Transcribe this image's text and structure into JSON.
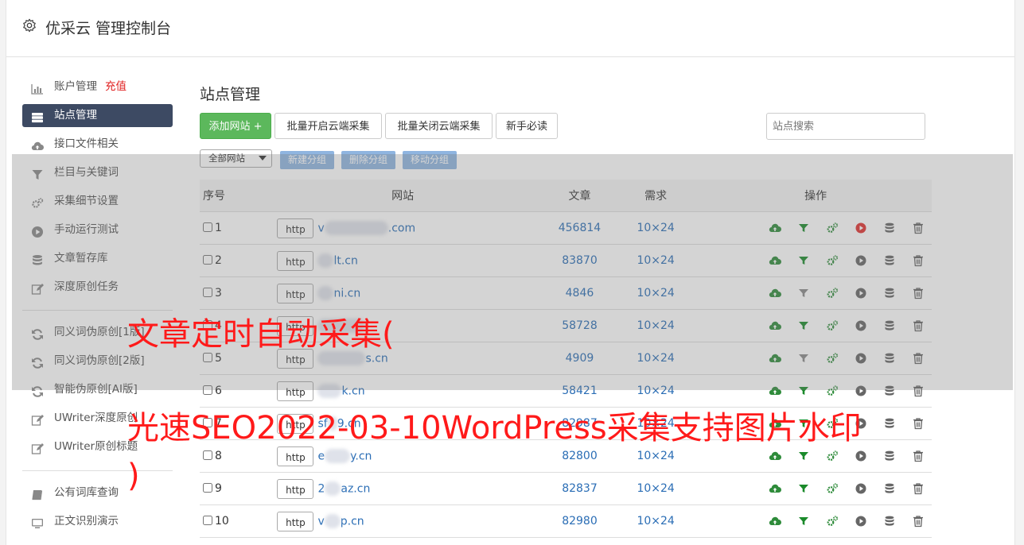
{
  "app": {
    "title": "优采云 管理控制台"
  },
  "sidebar": {
    "items": [
      {
        "label": "账户管理",
        "extra": "充值",
        "icon": "bar-chart-icon"
      },
      {
        "label": "站点管理",
        "icon": "server-icon",
        "active": true
      },
      {
        "label": "接口文件相关",
        "icon": "cloud-upload-icon"
      },
      {
        "label": "栏目与关键词",
        "icon": "filter-icon"
      },
      {
        "label": "采集细节设置",
        "icon": "cogs-icon"
      },
      {
        "label": "手动运行测试",
        "icon": "play-circle-icon"
      },
      {
        "label": "文章暂存库",
        "icon": "database-icon"
      },
      {
        "label": "深度原创任务",
        "icon": "edit-icon"
      },
      {
        "label": "同义词伪原创[1版]",
        "icon": "refresh-icon"
      },
      {
        "label": "同义词伪原创[2版]",
        "icon": "refresh-icon"
      },
      {
        "label": "智能伪原创[AI版]",
        "icon": "refresh-icon"
      },
      {
        "label": "UWriter深度原创",
        "icon": "edit-icon"
      },
      {
        "label": "UWriter原创标题",
        "icon": "edit-icon"
      },
      {
        "label": "公有词库查询",
        "icon": "book-icon"
      },
      {
        "label": "正文识别演示",
        "icon": "monitor-icon"
      }
    ]
  },
  "main": {
    "title": "站点管理",
    "toolbar": {
      "add_site": "添加网站 +",
      "batch_open": "批量开启云端采集",
      "batch_close": "批量关闭云端采集",
      "newbie": "新手必读"
    },
    "search_placeholder": "站点搜索",
    "group_select": "全部网站",
    "group_buttons": {
      "new": "新建分组",
      "delete": "删除分组",
      "move": "移动分组"
    },
    "table": {
      "headers": {
        "no": "序号",
        "site": "网站",
        "articles": "文章",
        "demand": "需求",
        "ops": "操作"
      },
      "rows": [
        {
          "no": "1",
          "proto": "http",
          "prefix": "v",
          "domain": ".com",
          "articles": "456814",
          "demand": "10×24",
          "play_active": true,
          "filter_active": true
        },
        {
          "no": "2",
          "proto": "http",
          "prefix": "",
          "domain": "lt.cn",
          "articles": "83870",
          "demand": "10×24",
          "play_active": false,
          "filter_active": true
        },
        {
          "no": "3",
          "proto": "http",
          "prefix": "",
          "domain": "ni.cn",
          "articles": "4846",
          "demand": "10×24",
          "play_active": false,
          "filter_active": false
        },
        {
          "no": "4",
          "proto": "http",
          "prefix": "",
          "domain": "",
          "articles": "58728",
          "demand": "10×24",
          "play_active": false,
          "filter_active": true
        },
        {
          "no": "5",
          "proto": "http",
          "prefix": "",
          "domain": "s.cn",
          "articles": "4909",
          "demand": "10×24",
          "play_active": false,
          "filter_active": false
        },
        {
          "no": "6",
          "proto": "http",
          "prefix": "",
          "domain": "k.cn",
          "articles": "58421",
          "demand": "10×24",
          "play_active": false,
          "filter_active": true
        },
        {
          "no": "7",
          "proto": "http",
          "prefix": "sf",
          "domain": "9.cn",
          "articles": "82987",
          "demand": "10×24",
          "play_active": false,
          "filter_active": true
        },
        {
          "no": "8",
          "proto": "http",
          "prefix": "e",
          "domain": "y.cn",
          "articles": "82800",
          "demand": "10×24",
          "play_active": false,
          "filter_active": true
        },
        {
          "no": "9",
          "proto": "http",
          "prefix": "2",
          "domain": "az.cn",
          "articles": "82837",
          "demand": "10×24",
          "play_active": false,
          "filter_active": true
        },
        {
          "no": "10",
          "proto": "http",
          "prefix": "v",
          "domain": "p.cn",
          "articles": "82980",
          "demand": "10×24",
          "play_active": false,
          "filter_active": true
        }
      ]
    }
  },
  "overlay": {
    "line1": "文章定时自动采集(",
    "line2": "光速SEO2022-03-10WordPress采集支持图片水印",
    "line3": ")"
  },
  "colors": {
    "accent_green": "#5cb85c",
    "sidebar_active": "#3d4a63",
    "link_blue": "#2a6db5",
    "overlay_red": "#ff1a1a",
    "group_btn": "#8fb5e0"
  }
}
